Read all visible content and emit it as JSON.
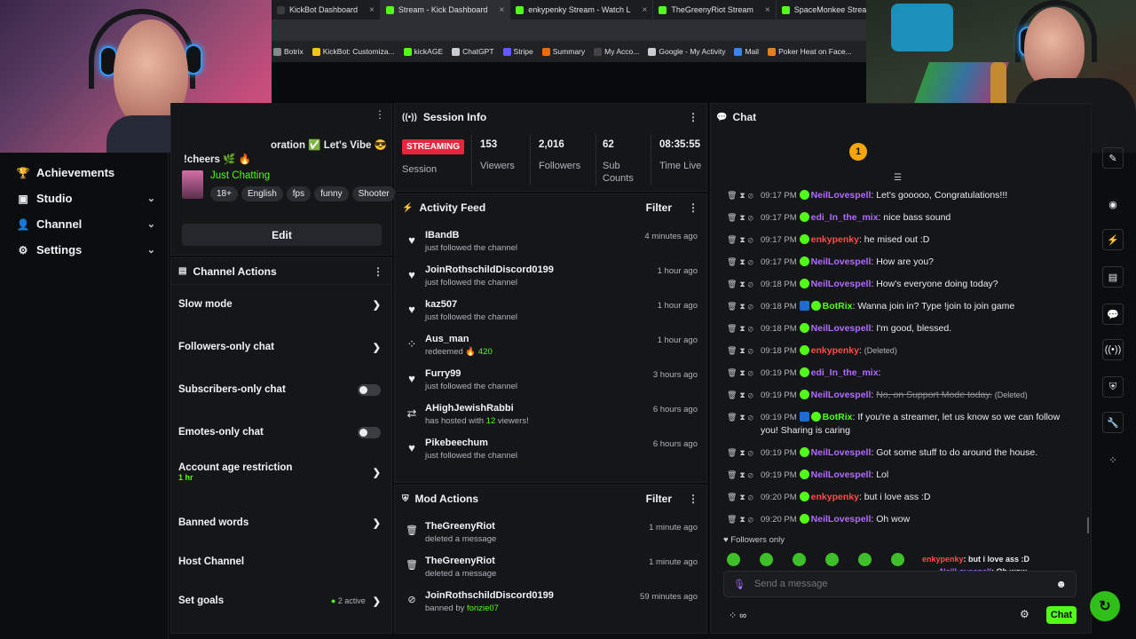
{
  "browser": {
    "tabs": [
      {
        "label": "KickBot Dashboard",
        "color": "#3b3b3b",
        "active": false,
        "close": "×"
      },
      {
        "label": "Stream - Kick Dashboard",
        "color": "#53fc18",
        "active": true,
        "close": "×"
      },
      {
        "label": "enkypenky Stream - Watch L",
        "color": "#53fc18",
        "active": false,
        "close": "×"
      },
      {
        "label": "TheGreenyRiot Stream",
        "color": "#53fc18",
        "active": false,
        "close": "×"
      },
      {
        "label": "SpaceMonkee Stream",
        "color": "#53fc18",
        "active": false,
        "close": ""
      }
    ],
    "bookmarks": [
      {
        "label": "Botrix",
        "color": "#888"
      },
      {
        "label": "KickBot: Customiza...",
        "color": "#f5c518"
      },
      {
        "label": "kickAGE",
        "color": "#53fc18"
      },
      {
        "label": "ChatGPT",
        "color": "#cccccc"
      },
      {
        "label": "Stripe",
        "color": "#635bff"
      },
      {
        "label": "Summary",
        "color": "#ff6a00"
      },
      {
        "label": "My Acco...",
        "color": "#444"
      },
      {
        "label": "Google - My Activity",
        "color": "#cccccc"
      },
      {
        "label": "Mail",
        "color": "#3b82f6"
      },
      {
        "label": "Poker Heat on Face...",
        "color": "#e67e22"
      }
    ]
  },
  "nav": {
    "items": [
      {
        "label": "Achievements",
        "icon": "trophy-icon",
        "glyph": "🏆",
        "chevron": ""
      },
      {
        "label": "Studio",
        "icon": "studio-icon",
        "glyph": "▣",
        "chevron": "⌄"
      },
      {
        "label": "Channel",
        "icon": "user-icon",
        "glyph": "👤",
        "chevron": "⌄"
      },
      {
        "label": "Settings",
        "icon": "gear-icon",
        "glyph": "⚙",
        "chevron": "⌄"
      }
    ]
  },
  "stream_info": {
    "title_fragment": "oration",
    "title_rest": "Let's Vibe",
    "cmd": "!cheers",
    "category": "Just Chatting",
    "tags": [
      "18+",
      "English",
      "fps",
      "funny",
      "Shooter"
    ],
    "edit_label": "Edit"
  },
  "channel_actions": {
    "title": "Channel Actions",
    "rows": [
      {
        "label": "Slow mode",
        "control": "arrow",
        "sub": ""
      },
      {
        "label": "Followers-only chat",
        "control": "arrow",
        "sub": ""
      },
      {
        "label": "Subscribers-only chat",
        "control": "toggle",
        "sub": ""
      },
      {
        "label": "Emotes-only chat",
        "control": "toggle",
        "sub": ""
      },
      {
        "label": "Account age restriction",
        "control": "arrow",
        "sub": "1 hr"
      },
      {
        "label": "Banned words",
        "control": "arrow",
        "sub": ""
      },
      {
        "label": "Host Channel",
        "control": "none",
        "sub": ""
      },
      {
        "label": "Set goals",
        "control": "arrow",
        "sub": "",
        "note": "2 active"
      }
    ]
  },
  "session": {
    "title": "Session Info",
    "status": "STREAMING",
    "status_label": "Session",
    "stats": [
      {
        "value": "153",
        "label": "Viewers"
      },
      {
        "value": "2,016",
        "label": "Followers"
      },
      {
        "value": "62",
        "label": "Sub Counts"
      },
      {
        "value": "08:35:55",
        "label": "Time Live"
      }
    ]
  },
  "activity": {
    "title": "Activity Feed",
    "filter_label": "Filter",
    "items": [
      {
        "name": "IBandB",
        "text": "just followed the channel",
        "time": "4 minutes ago",
        "icon": "heart-icon",
        "glyph": "♥"
      },
      {
        "name": "JoinRothschildDiscord0199",
        "text": "just followed the channel",
        "time": "1 hour ago",
        "icon": "heart-icon",
        "glyph": "♥"
      },
      {
        "name": "kaz507",
        "text": "just followed the channel",
        "time": "1 hour ago",
        "icon": "heart-icon",
        "glyph": "♥"
      },
      {
        "name": "Aus_man",
        "text": "redeemed",
        "points": "420",
        "time": "1 hour ago",
        "icon": "points-icon",
        "glyph": "⁘"
      },
      {
        "name": "Furry99",
        "text": "just followed the channel",
        "time": "3 hours ago",
        "icon": "heart-icon",
        "glyph": "♥"
      },
      {
        "name": "AHighJewishRabbi",
        "text": "has hosted with",
        "viewers": "12",
        "text2": "viewers!",
        "time": "6 hours ago",
        "icon": "host-icon",
        "glyph": "⇄"
      },
      {
        "name": "Pikebeechum",
        "text": "just followed the channel",
        "time": "6 hours ago",
        "icon": "heart-icon",
        "glyph": "♥"
      }
    ]
  },
  "mod": {
    "title": "Mod Actions",
    "filter_label": "Filter",
    "items": [
      {
        "name": "TheGreenyRiot",
        "text": "deleted a message",
        "time": "1 minute ago",
        "icon": "trash-icon",
        "glyph": "🗑"
      },
      {
        "name": "TheGreenyRiot",
        "text": "deleted a message",
        "time": "1 minute ago",
        "icon": "trash-icon",
        "glyph": "🗑"
      },
      {
        "name": "JoinRothschildDiscord0199",
        "text": "banned by",
        "by": "fonzie07",
        "time": "59 minutes ago",
        "icon": "ban-icon",
        "glyph": "⊘"
      }
    ]
  },
  "chat": {
    "title": "Chat",
    "messages": [
      {
        "time": "09:17 PM",
        "user": "NeilLovespell",
        "color": "purple",
        "text": "Let's gooooo, Congratulations!!!",
        "deleted": false
      },
      {
        "time": "09:17 PM",
        "user": "edi_In_the_mix",
        "color": "purple",
        "text": "nice bass sound",
        "deleted": false
      },
      {
        "time": "09:17 PM",
        "user": "enkypenky",
        "color": "red",
        "text": "he mised out :D",
        "deleted": false
      },
      {
        "time": "09:17 PM",
        "user": "NeilLovespell",
        "color": "purple",
        "text": "How are you?",
        "deleted": false
      },
      {
        "time": "09:18 PM",
        "user": "NeilLovespell",
        "color": "purple",
        "text": "How's everyone doing today?",
        "deleted": false
      },
      {
        "time": "09:18 PM",
        "user": "BotRix",
        "color": "green",
        "text": "Wanna join in? Type !join to join game",
        "deleted": false,
        "bot": true
      },
      {
        "time": "09:18 PM",
        "user": "NeilLovespell",
        "color": "purple",
        "text": "I'm good, blessed.",
        "deleted": false
      },
      {
        "time": "09:18 PM",
        "user": "enkypenky",
        "color": "red",
        "text": "",
        "deleted": true,
        "deleted_label": "(Deleted)"
      },
      {
        "time": "09:19 PM",
        "user": "edi_In_the_mix",
        "color": "purple",
        "text": "",
        "deleted": false
      },
      {
        "time": "09:19 PM",
        "user": "NeilLovespell",
        "color": "purple",
        "text": "No, on Support Mode today.",
        "deleted": true,
        "deleted_label": "(Deleted)"
      },
      {
        "time": "09:19 PM",
        "user": "BotRix",
        "color": "green",
        "text": "If you're a streamer, let us know so we can follow you! Sharing is caring",
        "deleted": false,
        "bot": true
      },
      {
        "time": "09:19 PM",
        "user": "NeilLovespell",
        "color": "purple",
        "text": "Got some stuff to do around the house.",
        "deleted": false
      },
      {
        "time": "09:19 PM",
        "user": "NeilLovespell",
        "color": "purple",
        "text": "Lol",
        "deleted": false
      },
      {
        "time": "09:20 PM",
        "user": "enkypenky",
        "color": "red",
        "text": "but i love ass :D",
        "deleted": false
      },
      {
        "time": "09:20 PM",
        "user": "NeilLovespell",
        "color": "purple",
        "text": "Oh wow",
        "deleted": false
      }
    ],
    "followers_only": "Followers only",
    "input_placeholder": "Send a message",
    "send_label": "Chat",
    "overlay_line1_user": "enkypenky",
    "overlay_line1_text": ": but i love ass :D",
    "overlay_line2_user": "NeilLovespell",
    "overlay_line2_text": ": Oh wow"
  },
  "colors": {
    "accent": "#53fc18",
    "streaming": "#e7263d",
    "purple_user": "#b26bff",
    "red_user": "#ff4c4c"
  }
}
